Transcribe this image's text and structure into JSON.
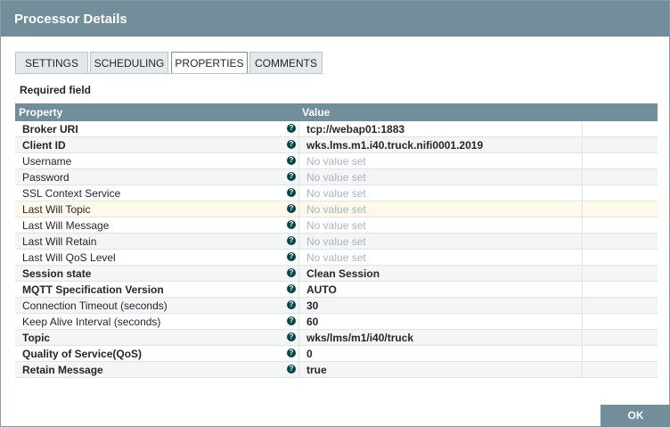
{
  "dialog": {
    "title": "Processor Details",
    "tabs": [
      {
        "label": "SETTINGS"
      },
      {
        "label": "SCHEDULING"
      },
      {
        "label": "PROPERTIES"
      },
      {
        "label": "COMMENTS"
      }
    ],
    "active_tab": "PROPERTIES",
    "required_label": "Required field",
    "table": {
      "columns": [
        "Property",
        "Value"
      ],
      "rows": [
        {
          "property": "Broker URI",
          "value": "tcp://webap01:1883",
          "required": true,
          "is_set": true
        },
        {
          "property": "Client ID",
          "value": "wks.lms.m1.i40.truck.nifi0001.2019",
          "required": true,
          "is_set": true
        },
        {
          "property": "Username",
          "value": "No value set",
          "required": false,
          "is_set": false
        },
        {
          "property": "Password",
          "value": "No value set",
          "required": false,
          "is_set": false
        },
        {
          "property": "SSL Context Service",
          "value": "No value set",
          "required": false,
          "is_set": false
        },
        {
          "property": "Last Will Topic",
          "value": "No value set",
          "required": false,
          "is_set": false
        },
        {
          "property": "Last Will Message",
          "value": "No value set",
          "required": false,
          "is_set": false
        },
        {
          "property": "Last Will Retain",
          "value": "No value set",
          "required": false,
          "is_set": false
        },
        {
          "property": "Last Will QoS Level",
          "value": "No value set",
          "required": false,
          "is_set": false
        },
        {
          "property": "Session state",
          "value": "Clean Session",
          "required": true,
          "is_set": true
        },
        {
          "property": "MQTT Specification Version",
          "value": "AUTO",
          "required": true,
          "is_set": true
        },
        {
          "property": "Connection Timeout (seconds)",
          "value": "30",
          "required": false,
          "is_set": true
        },
        {
          "property": "Keep Alive Interval (seconds)",
          "value": "60",
          "required": false,
          "is_set": true
        },
        {
          "property": "Topic",
          "value": "wks/lms/m1/i40/truck",
          "required": true,
          "is_set": true
        },
        {
          "property": "Quality of Service(QoS)",
          "value": "0",
          "required": true,
          "is_set": true
        },
        {
          "property": "Retain Message",
          "value": "true",
          "required": true,
          "is_set": true
        }
      ],
      "highlighted_row": "Last Will Topic"
    },
    "ok_label": "OK"
  },
  "colors": {
    "title_bar": "#728e9b",
    "help_icon": "#004849",
    "highlight_row": "#fdf8e8",
    "unset_text": "#aab4b9"
  },
  "icons": {
    "help": "question-circle-icon"
  }
}
